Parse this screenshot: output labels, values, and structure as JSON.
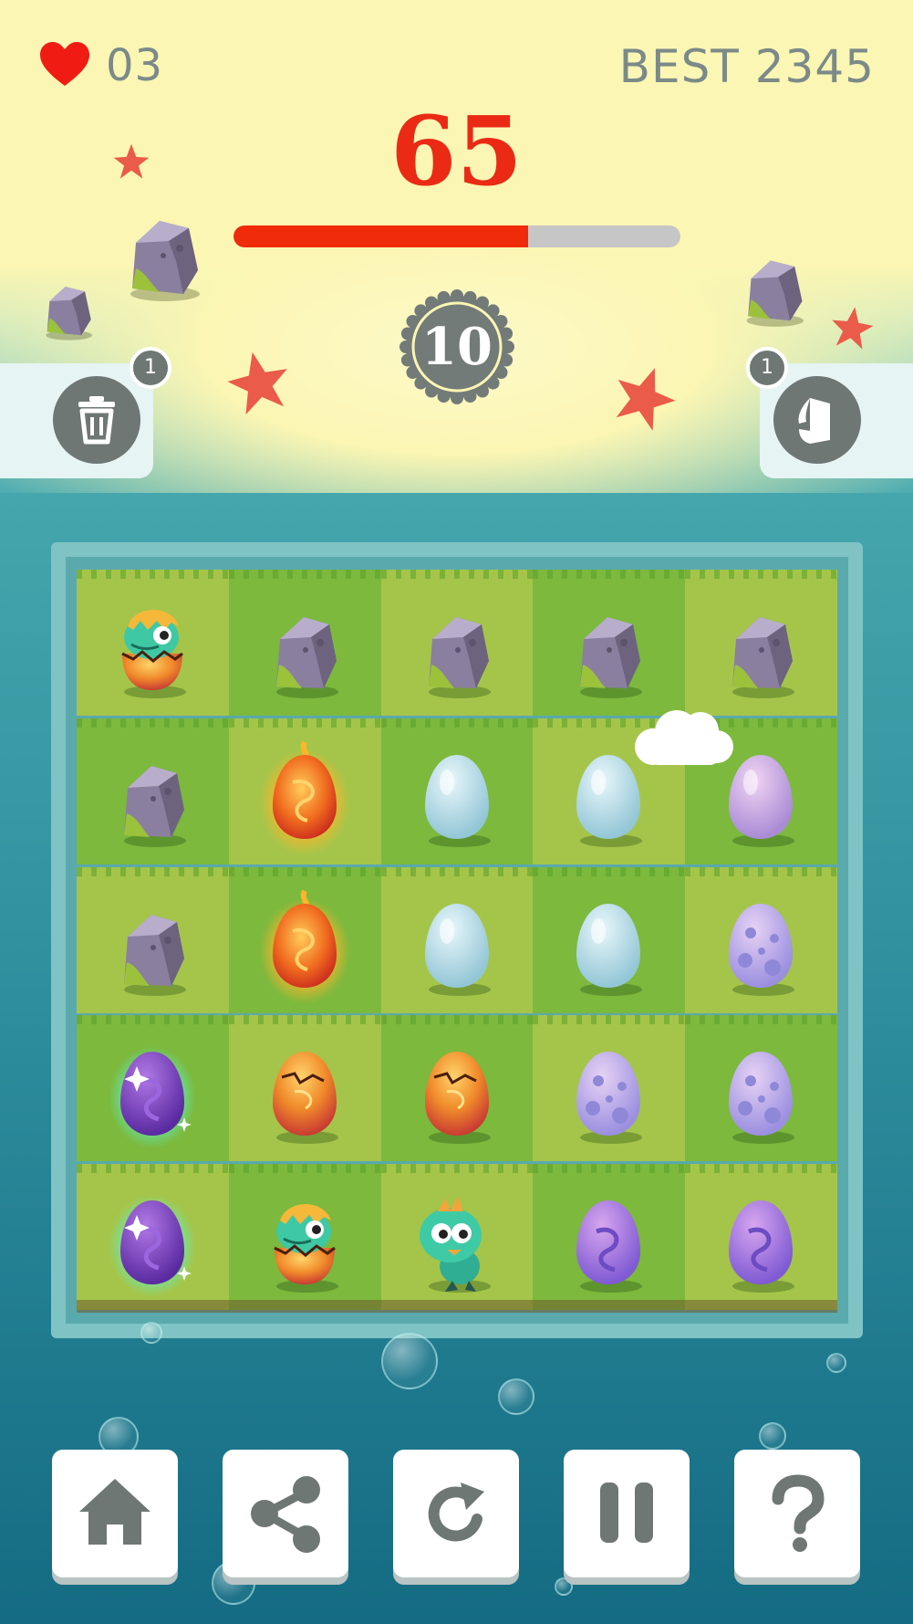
{
  "hud": {
    "lives_icon": "heart-icon",
    "lives": "03",
    "best_label": "BEST 2345",
    "moves_left": "65",
    "progress": 0.66,
    "level": "10"
  },
  "powerups": {
    "trash": {
      "icon": "trash-icon",
      "count": "1"
    },
    "bomb": {
      "icon": "bomb-icon",
      "count": "1"
    }
  },
  "board": {
    "rows": [
      [
        "hatching-dragon",
        "rock",
        "rock",
        "rock",
        "rock"
      ],
      [
        "rock",
        "fire-egg",
        "plain-egg",
        "plain-egg",
        "pink-egg"
      ],
      [
        "rock",
        "fire-egg",
        "plain-egg",
        "plain-egg",
        "spotted-egg"
      ],
      [
        "magic-egg",
        "cracked-egg",
        "cracked-egg",
        "spotted-egg",
        "spotted-egg"
      ],
      [
        "magic-egg",
        "hatching-dragon",
        "baby-dragon",
        "swirl-egg",
        "swirl-egg"
      ]
    ]
  },
  "toolbar": [
    {
      "name": "home-button",
      "icon": "home-icon"
    },
    {
      "name": "share-button",
      "icon": "share-icon"
    },
    {
      "name": "restart-button",
      "icon": "restart-icon"
    },
    {
      "name": "pause-button",
      "icon": "pause-icon"
    },
    {
      "name": "help-button",
      "icon": "help-icon"
    }
  ],
  "colors": {
    "accent_red": "#ea2a14",
    "hud_gray": "#7b8a89",
    "tile_light": "#a5c54a",
    "tile_dark": "#7cb93d",
    "button_icon": "#6f7775"
  }
}
